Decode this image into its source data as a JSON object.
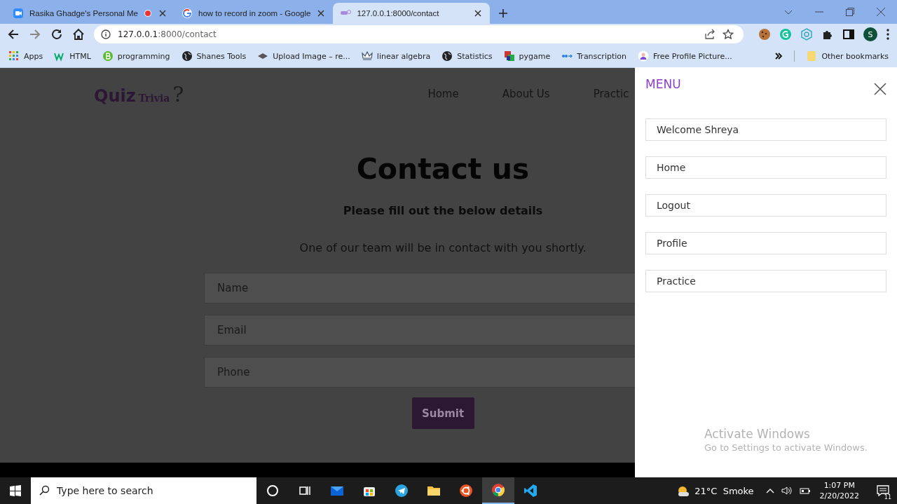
{
  "browser": {
    "tabs": [
      {
        "title": "Rasika Ghadge's Personal Me",
        "kind": "zoom",
        "recording": true,
        "selected": false
      },
      {
        "title": "how to record in zoom - Google",
        "kind": "google",
        "recording": false,
        "selected": false
      },
      {
        "title": "127.0.0.1:8000/contact",
        "kind": "site",
        "recording": false,
        "selected": true
      }
    ],
    "address": {
      "host": "127.0.0.1",
      "rest": ":8000/contact"
    },
    "profile": "S",
    "bookmarks": [
      {
        "label": "Apps",
        "kind": "apps"
      },
      {
        "label": "HTML",
        "kind": "w3"
      },
      {
        "label": "programming",
        "kind": "b"
      },
      {
        "label": "Shanes Tools",
        "kind": "globe"
      },
      {
        "label": "Upload Image – re...",
        "kind": "stack"
      },
      {
        "label": "linear algebra",
        "kind": "crown"
      },
      {
        "label": "Statistics",
        "kind": "globe"
      },
      {
        "label": "pygame",
        "kind": "squares"
      },
      {
        "label": "Transcription",
        "kind": "otter"
      },
      {
        "label": "Free Profile Picture...",
        "kind": "person"
      }
    ],
    "other_bookmarks": "Other bookmarks"
  },
  "page": {
    "logo": {
      "word": "Quiz",
      "small": "Trivia",
      "mark": "?"
    },
    "nav": [
      "Home",
      "About Us",
      "Practic"
    ],
    "heading": "Contact us",
    "subheading": "Please fill out the below details",
    "note": "One of our team will be in contact with you shortly.",
    "fields": [
      {
        "placeholder": "Name"
      },
      {
        "placeholder": "Email"
      },
      {
        "placeholder": "Phone"
      }
    ],
    "submit": "Submit"
  },
  "menu": {
    "title": "MENU",
    "items": [
      "Welcome Shreya",
      "Home",
      "Logout",
      "Profile",
      "Practice"
    ]
  },
  "activation": {
    "title": "Activate Windows",
    "text": "Go to Settings to activate Windows."
  },
  "taskbar": {
    "search_placeholder": "Type here to search",
    "apps": [
      {
        "kind": "cortana",
        "active": false
      },
      {
        "kind": "taskview",
        "active": false
      },
      {
        "kind": "mail",
        "active": false
      },
      {
        "kind": "store",
        "active": false
      },
      {
        "kind": "telegram",
        "active": false
      },
      {
        "kind": "files",
        "active": false
      },
      {
        "kind": "ubuntu",
        "active": false
      },
      {
        "kind": "chrome",
        "active": true
      },
      {
        "kind": "vscode",
        "active": false
      }
    ],
    "weather": "21°C  Smoke",
    "time": "1:07 PM",
    "date": "2/20/2022",
    "notifications": "11"
  }
}
